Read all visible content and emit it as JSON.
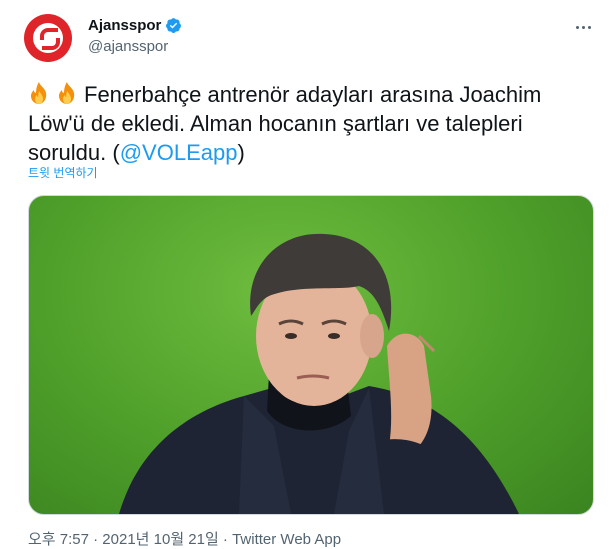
{
  "author": {
    "display_name": "Ajansspor",
    "handle": "@ajansspor",
    "verified": true
  },
  "tweet": {
    "text": "Fenerbahçe antrenör adayları arasına Joachim Löw'ü de ekledi. Alman hocanın şartları ve talepleri soruldu. (",
    "mention": "@VOLEapp",
    "text_end": ")",
    "emoji": [
      "fire-icon",
      "fire-icon"
    ],
    "translate_label": "트윗 번역하기",
    "meta": "오후 7:57 · 2021년 10월 21일 · Twitter Web App"
  },
  "media": {
    "description_icon": "photo-of-man-in-black-coat"
  },
  "colors": {
    "accent": "#1d9bf0",
    "brand": "#e0252a",
    "text": "#0f1419",
    "secondary": "#536471"
  }
}
